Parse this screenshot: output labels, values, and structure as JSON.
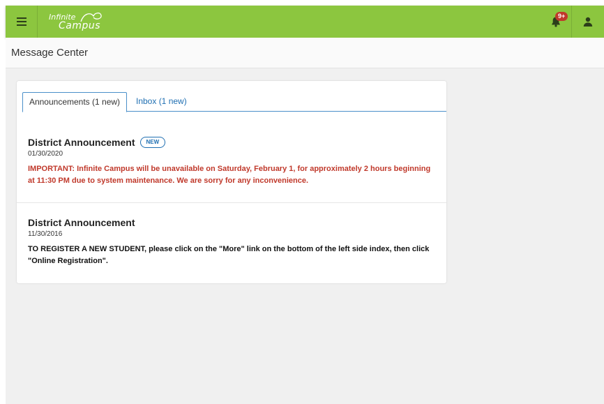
{
  "topbar": {
    "logo_line1": "Infinite",
    "logo_line2": "Campus",
    "notification_count": "9+",
    "icons": {
      "menu": "hamburger-icon",
      "bell": "bell-icon",
      "user": "user-icon"
    },
    "colors": {
      "bar": "#8cc63f",
      "badge": "#c0392b"
    }
  },
  "page": {
    "title": "Message Center"
  },
  "tabs": [
    {
      "label": "Announcements (1 new)",
      "active": true
    },
    {
      "label": "Inbox (1 new)",
      "active": false
    }
  ],
  "announcements": [
    {
      "title": "District Announcement",
      "badge": "NEW",
      "date": "01/30/2020",
      "body": "IMPORTANT:  Infinite Campus will be unavailable on Saturday, February 1, for approximately 2 hours beginning at 11:30 PM due to system maintenance.  We are sorry for any inconvenience.",
      "color": "#c0392b"
    },
    {
      "title": "District Announcement",
      "date": "11/30/2016",
      "body": "TO REGISTER A NEW STUDENT, please click on the \"More\" link on the bottom of the left side index, then click \"Online Registration\".",
      "color": "#111111"
    }
  ]
}
